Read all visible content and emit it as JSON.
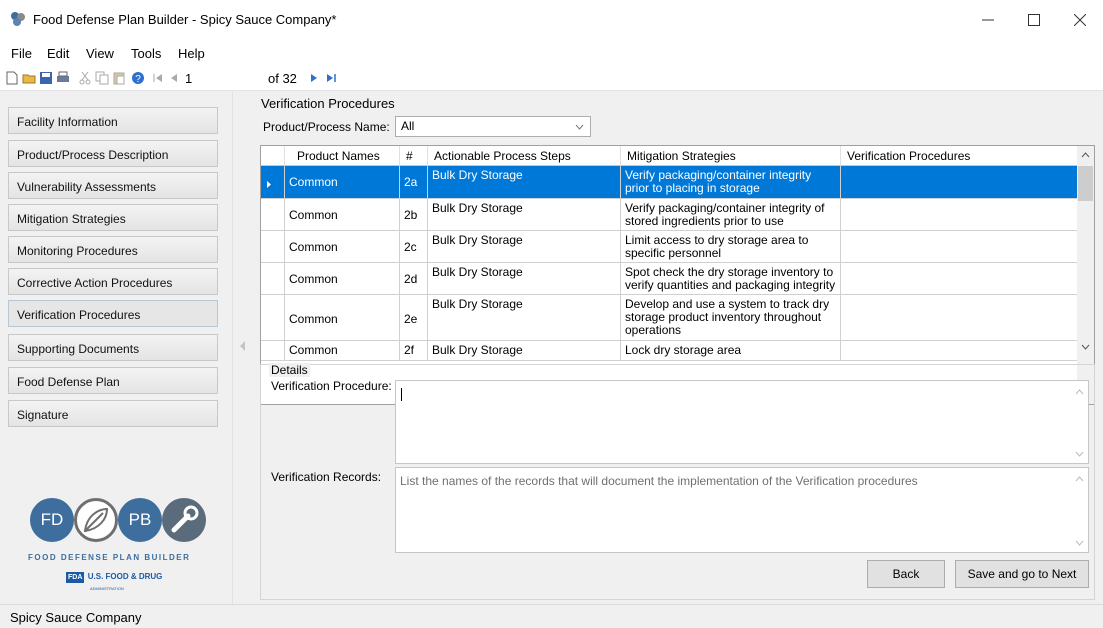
{
  "window": {
    "title": "Food Defense Plan Builder - Spicy Sauce Company*",
    "minimize": "—",
    "maximize": "☐",
    "close": "✕"
  },
  "menu": [
    "File",
    "Edit",
    "View",
    "Tools",
    "Help"
  ],
  "toolbar": {
    "page_current": "1",
    "page_total": "of 32"
  },
  "sidebar": {
    "items": [
      "Facility Information",
      "Product/Process Description",
      "Vulnerability Assessments",
      "Mitigation Strategies",
      "Monitoring Procedures",
      "Corrective Action Procedures",
      "Verification Procedures",
      "Supporting Documents",
      "Food Defense Plan",
      "Signature"
    ],
    "active_index": 6,
    "logo_letters": [
      "FD",
      "PB"
    ],
    "logo_caption": "FOOD DEFENSE PLAN BUILDER",
    "fda_text": "U.S. FOOD & DRUG",
    "fda_sub": "ADMINISTRATION",
    "fda_badge": "FDA"
  },
  "main": {
    "title": "Verification Procedures",
    "filter_label": "Product/Process Name:",
    "filter_value": "All"
  },
  "grid": {
    "headers": [
      "Product Names",
      "#",
      "Actionable Process Steps",
      "Mitigation Strategies",
      "Verification Procedures"
    ],
    "rows": [
      {
        "product": "Common",
        "num": "2a",
        "step": "Bulk Dry Storage",
        "mitigation": "Verify packaging/container integrity prior to placing in storage",
        "verification": "",
        "selected": true
      },
      {
        "product": "Common",
        "num": "2b",
        "step": "Bulk Dry Storage",
        "mitigation": "Verify packaging/container integrity of stored ingredients prior to use",
        "verification": ""
      },
      {
        "product": "Common",
        "num": "2c",
        "step": "Bulk Dry Storage",
        "mitigation": "Limit access to dry storage area to specific personnel",
        "verification": ""
      },
      {
        "product": "Common",
        "num": "2d",
        "step": "Bulk Dry Storage",
        "mitigation": "Spot check the dry storage inventory to verify quantities and packaging integrity",
        "verification": ""
      },
      {
        "product": "Common",
        "num": "2e",
        "step": "Bulk Dry Storage",
        "mitigation": "Develop and use a system to track dry storage product inventory throughout operations",
        "verification": ""
      },
      {
        "product": "Common",
        "num": "2f",
        "step": "Bulk Dry Storage",
        "mitigation": "Lock dry storage area",
        "verification": ""
      }
    ]
  },
  "details": {
    "legend": "Details",
    "procedure_label": "Verification Procedure:",
    "procedure_value": "",
    "records_label": "Verification Records:",
    "records_placeholder": "List the names of the records that will document the implementation of the Verification procedures"
  },
  "buttons": {
    "back": "Back",
    "next": "Save and go to Next"
  },
  "status": {
    "company": "Spicy Sauce Company"
  },
  "colors": {
    "selection": "#0078d7",
    "logo_blue": "#3d6e9e"
  }
}
